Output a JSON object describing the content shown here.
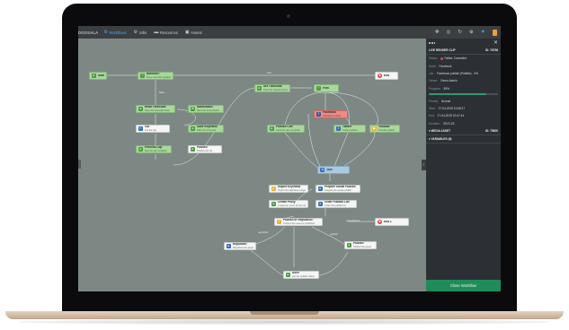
{
  "app": {
    "brand": "DOOSALA",
    "nav": [
      {
        "label": "Workflows",
        "icon": "workflow-icon",
        "active": true
      },
      {
        "label": "Jobs",
        "icon": "jobs-icon",
        "active": false
      },
      {
        "label": "Resources",
        "icon": "folder-icon",
        "active": false
      },
      {
        "label": "Assets",
        "icon": "assets-icon",
        "active": false
      }
    ],
    "toolbar_icons": [
      "move-icon",
      "target-icon",
      "refresh-icon",
      "add-icon",
      "filter-icon",
      "document-icon"
    ]
  },
  "colors": {
    "accent": "#4fa3e8",
    "node_green": "#a9d79c",
    "node_red": "#f08a85",
    "node_blue": "#a8c9e0",
    "success": "#1f8c5a"
  },
  "canvas": {
    "nodes": [
      {
        "id": "start",
        "title": "Start",
        "sub": "",
        "color": "green",
        "icon": "g"
      },
      {
        "id": "random",
        "title": "Random?",
        "sub": "Flip a coin with variable",
        "color": "green",
        "icon": "g"
      },
      {
        "id": "end_top",
        "title": "End",
        "sub": "",
        "color": "white",
        "icon": "r"
      },
      {
        "id": "set_timecode",
        "title": "Set Timecode",
        "sub": "Pass the original timecode",
        "color": "green",
        "icon": "g"
      },
      {
        "id": "fork",
        "title": "Fork",
        "sub": "",
        "color": "green",
        "icon": "g"
      },
      {
        "id": "read_timecode",
        "title": "Read Timecode",
        "sub": "Pass the timecode back",
        "color": "green",
        "icon": "g"
      },
      {
        "id": "notification",
        "title": "Notification",
        "sub": "Pass the transcription",
        "color": "green",
        "icon": "g"
      },
      {
        "id": "facebook",
        "title": "Facebook",
        "sub": "Facebook publish",
        "color": "red",
        "icon": "fb"
      },
      {
        "id": "cut",
        "title": "Cut",
        "sub": "Cut the clip",
        "color": "green",
        "icon": "b"
      },
      {
        "id": "save_keyframe",
        "title": "Save Keyframe",
        "sub": "Pass the timecode",
        "color": "green",
        "icon": "g"
      },
      {
        "id": "publish_cliff",
        "title": "Publish Cliff",
        "sub": "Send the clip to publish",
        "color": "green",
        "icon": "g"
      },
      {
        "id": "twitter",
        "title": "Twitter",
        "sub": "Twitter publish",
        "color": "green",
        "icon": "b"
      },
      {
        "id": "youtube",
        "title": "Youtube",
        "sub": "Youtube publish",
        "color": "green",
        "icon": "y"
      },
      {
        "id": "process_clip",
        "title": "Process Clip",
        "sub": "Run the clip workflow",
        "color": "green",
        "icon": "g"
      },
      {
        "id": "publish",
        "title": "Publish",
        "sub": "Publish the clip",
        "color": "green",
        "icon": "g"
      },
      {
        "id": "join",
        "title": "Join",
        "sub": "",
        "color": "blue",
        "icon": "b"
      },
      {
        "id": "import_keyframe",
        "title": "Import Keyframe",
        "sub": "Import the keyframe image",
        "color": "white",
        "icon": "y"
      },
      {
        "id": "prepare_social",
        "title": "Prepare Social Publish",
        "sub": "Prepare the social publish",
        "color": "white",
        "icon": "b"
      },
      {
        "id": "create_proxy",
        "title": "Create Proxy",
        "sub": "Create the proxy for the clip",
        "color": "white",
        "icon": "g"
      },
      {
        "id": "order_publish",
        "title": "Order Publish List",
        "sub": "Order the publish list",
        "color": "white",
        "icon": "b"
      },
      {
        "id": "publish_republish",
        "title": "Publish or Republish?",
        "sub": "Check if the asset is published",
        "color": "white",
        "icon": "y"
      },
      {
        "id": "end_mid",
        "title": "End 1",
        "sub": "",
        "color": "white",
        "icon": "r"
      },
      {
        "id": "republish",
        "title": "Republish",
        "sub": "Republish the asset",
        "color": "white",
        "icon": "b"
      },
      {
        "id": "publish_bottom",
        "title": "Publish",
        "sub": "Publish the asset",
        "color": "white",
        "icon": "g"
      },
      {
        "id": "done",
        "title": "Done",
        "sub": "Set the publish status",
        "color": "white",
        "icon": "g"
      }
    ],
    "edge_labels": [
      "false",
      "true",
      "republish",
      "publish",
      "unpublished"
    ]
  },
  "panel": {
    "section_title": "LIVE RENDER CLIP",
    "section_id": "ID: 78756",
    "rows": [
      {
        "k": "Status:",
        "v": "Failed, Cancelled",
        "status": true
      },
      {
        "k": "Node:",
        "v": "Facebook"
      },
      {
        "k": "Job:",
        "v": "Facebook publish (Publish) - 3%"
      },
      {
        "k": "Owner:",
        "v": "Demo Admin"
      },
      {
        "k": "Progress:",
        "v": "83%"
      }
    ],
    "progress": 0.83,
    "rows2": [
      {
        "k": "Priority:",
        "v": "Normal"
      },
      {
        "k": "Start:",
        "v": "17-04-2019 10:08:17"
      },
      {
        "k": "End:",
        "v": "17-04-2019 10:47:44"
      },
      {
        "k": "Duration:",
        "v": "39:21:26"
      }
    ],
    "media_title": "MEDIA ASSET",
    "media_id": "ID: 75800",
    "variables_title": "VARIABLES (6)",
    "close_label": "Close Workflow"
  }
}
